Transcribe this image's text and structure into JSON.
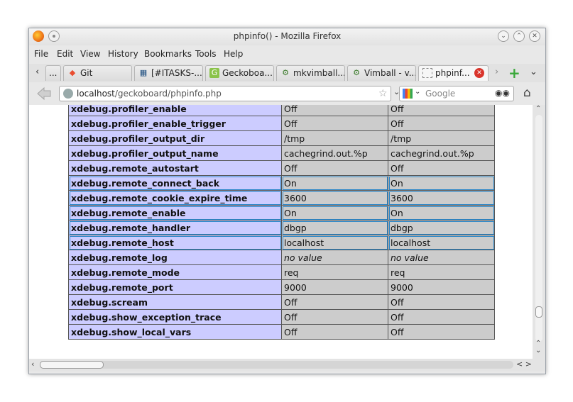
{
  "window": {
    "title": "phpinfo() - Mozilla Firefox"
  },
  "menubar": {
    "items": [
      {
        "label": "File"
      },
      {
        "label": "Edit"
      },
      {
        "label": "View"
      },
      {
        "label": "History"
      },
      {
        "label": "Bookmarks"
      },
      {
        "label": "Tools"
      },
      {
        "label": "Help"
      }
    ]
  },
  "tabs": {
    "overflow_label": "...",
    "items": [
      {
        "label": "Git",
        "icon": "git-icon"
      },
      {
        "label": "[#ITASKS-...",
        "icon": "jira-icon"
      },
      {
        "label": "Geckoboa...",
        "icon": "geckoboard-icon"
      },
      {
        "label": "mkvimball....",
        "icon": "github-icon"
      },
      {
        "label": "Vimball - v...",
        "icon": "github-icon"
      },
      {
        "label": "phpinf...",
        "icon": "page-icon",
        "active": true
      }
    ]
  },
  "navbar": {
    "url_host": "localhost",
    "url_path": "/geckoboard/phpinfo.php",
    "search_placeholder": "Google"
  },
  "table": {
    "no_value_label": "no value",
    "rows": [
      {
        "directive": "xdebug.profiler_enable",
        "local": "Off",
        "master": "Off",
        "highlight": false
      },
      {
        "directive": "xdebug.profiler_enable_trigger",
        "local": "Off",
        "master": "Off",
        "highlight": false
      },
      {
        "directive": "xdebug.profiler_output_dir",
        "local": "/tmp",
        "master": "/tmp",
        "highlight": false
      },
      {
        "directive": "xdebug.profiler_output_name",
        "local": "cachegrind.out.%p",
        "master": "cachegrind.out.%p",
        "highlight": false
      },
      {
        "directive": "xdebug.remote_autostart",
        "local": "Off",
        "master": "Off",
        "highlight": false
      },
      {
        "directive": "xdebug.remote_connect_back",
        "local": "On",
        "master": "On",
        "highlight": true
      },
      {
        "directive": "xdebug.remote_cookie_expire_time",
        "local": "3600",
        "master": "3600",
        "highlight": true
      },
      {
        "directive": "xdebug.remote_enable",
        "local": "On",
        "master": "On",
        "highlight": true
      },
      {
        "directive": "xdebug.remote_handler",
        "local": "dbgp",
        "master": "dbgp",
        "highlight": true
      },
      {
        "directive": "xdebug.remote_host",
        "local": "localhost",
        "master": "localhost",
        "highlight": true
      },
      {
        "directive": "xdebug.remote_log",
        "local": "no value",
        "master": "no value",
        "highlight": false,
        "italic": true
      },
      {
        "directive": "xdebug.remote_mode",
        "local": "req",
        "master": "req",
        "highlight": false
      },
      {
        "directive": "xdebug.remote_port",
        "local": "9000",
        "master": "9000",
        "highlight": false
      },
      {
        "directive": "xdebug.scream",
        "local": "Off",
        "master": "Off",
        "highlight": false
      },
      {
        "directive": "xdebug.show_exception_trace",
        "local": "Off",
        "master": "Off",
        "highlight": false
      },
      {
        "directive": "xdebug.show_local_vars",
        "local": "Off",
        "master": "Off",
        "highlight": false
      }
    ]
  },
  "colors": {
    "directive_bg": "#ccccff",
    "value_bg": "#cccccc",
    "highlight_border": "#2a86c8"
  }
}
